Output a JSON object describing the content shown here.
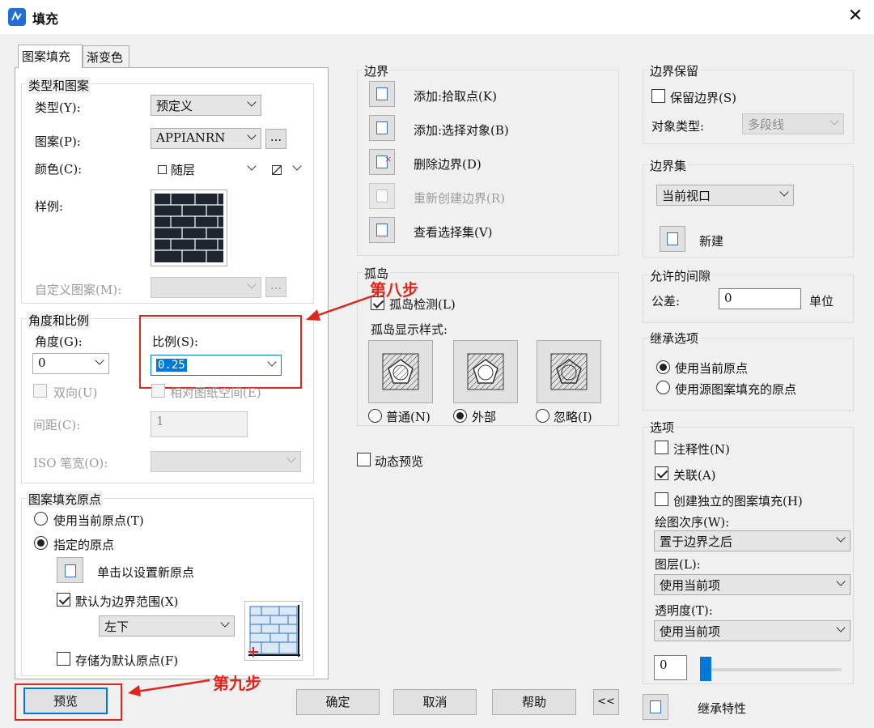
{
  "window": {
    "title": "填充",
    "close_glyph": "✕"
  },
  "tabs": [
    {
      "label": "图案填充",
      "active": true
    },
    {
      "label": "渐变色",
      "active": false
    }
  ],
  "type_pattern": {
    "group_label": "类型和图案",
    "type_label": "类型(Y):",
    "type_value": "预定义",
    "pattern_label": "图案(P):",
    "pattern_value": "APPIANRN",
    "browse_label": "...",
    "color_label": "颜色(C):",
    "color_value": "随层",
    "sample_label": "样例:",
    "custom_label": "自定义图案(M):",
    "custom_browse_label": "..."
  },
  "angle_scale": {
    "group_label": "角度和比例",
    "angle_label": "角度(G):",
    "angle_value": "0",
    "scale_label": "比例(S):",
    "scale_value": "0.25",
    "double_label": "双向(U)",
    "relative_label": "相对图纸空间(E)",
    "spacing_label": "间距(C):",
    "spacing_value": "1",
    "iso_label": "ISO 笔宽(O):"
  },
  "origin": {
    "group_label": "图案填充原点",
    "use_current": "使用当前原点(T)",
    "specified": "指定的原点",
    "click_set": "单击以设置新原点",
    "default_extent": "默认为边界范围(X)",
    "extent_value": "左下",
    "store_default": "存储为默认原点(F)"
  },
  "boundary": {
    "group_label": "边界",
    "add_pick": "添加:拾取点(K)",
    "add_select": "添加:选择对象(B)",
    "remove": "删除边界(D)",
    "recreate": "重新创建边界(R)",
    "view_selection": "查看选择集(V)"
  },
  "islands": {
    "group_label": "孤岛",
    "detect": "孤岛检测(L)",
    "style_label": "孤岛显示样式:",
    "normal": "普通(N)",
    "outer": "外部",
    "ignore": "忽略(I)"
  },
  "dynamic_preview": "动态预览",
  "retain": {
    "group_label": "边界保留",
    "retain_label": "保留边界(S)",
    "object_type_label": "对象类型:",
    "object_type_value": "多段线"
  },
  "boundary_set": {
    "group_label": "边界集",
    "value": "当前视口",
    "new_label": "新建"
  },
  "gap": {
    "group_label": "允许的间隙",
    "tolerance_label": "公差:",
    "tolerance_value": "0",
    "unit_label": "单位"
  },
  "inherit_options": {
    "group_label": "继承选项",
    "use_current": "使用当前原点",
    "use_source": "使用源图案填充的原点"
  },
  "options": {
    "group_label": "选项",
    "annotative": "注释性(N)",
    "associative": "关联(A)",
    "separate": "创建独立的图案填充(H)",
    "draw_order_label": "绘图次序(W):",
    "draw_order_value": "置于边界之后",
    "layer_label": "图层(L):",
    "layer_value": "使用当前项",
    "transparency_label": "透明度(T):",
    "transparency_value": "使用当前项",
    "transparency_amount": "0"
  },
  "buttons": {
    "preview": "预览",
    "ok": "确定",
    "cancel": "取消",
    "help": "帮助",
    "collapse": "<<",
    "inherit": "继承特性"
  },
  "annotations": {
    "step8": "第八步",
    "step9": "第九步",
    "color": "#e0261c"
  }
}
